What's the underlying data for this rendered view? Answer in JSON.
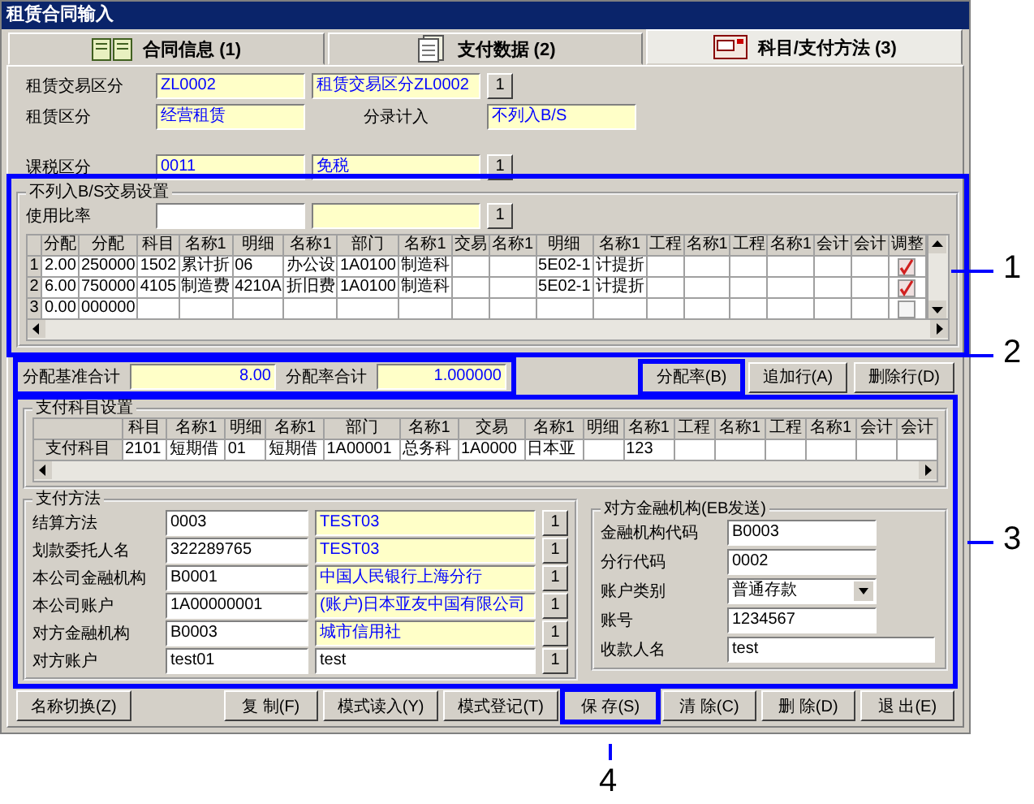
{
  "window": {
    "title": "租赁合同输入"
  },
  "tabs": [
    {
      "label": "合同信息 (1)",
      "selected": false
    },
    {
      "label": "支付数据 (2)",
      "selected": false
    },
    {
      "label": "科目/支付方法 (3)",
      "selected": true
    }
  ],
  "header": [
    {
      "kind": "pair",
      "label": "租赁交易区分",
      "code": "ZL0002",
      "name": "租赁交易区分ZL0002",
      "button": "1"
    },
    {
      "kind": "split",
      "label": "租赁区分",
      "code": "经营租赁",
      "label2": "分录计入",
      "name": "不列入B/S"
    },
    {
      "kind": "pair",
      "label": "课税区分",
      "code": "0011",
      "name": "免税",
      "button": "1"
    }
  ],
  "allocation": {
    "title": "不列入B/S交易设置",
    "callout": "1",
    "rate_label": "使用比率",
    "rate_button": "1",
    "columns": [
      "分配",
      "分配",
      "科目",
      "名称1",
      "明细",
      "名称1",
      "部门",
      "名称1",
      "交易",
      "名称1",
      "明细",
      "名称1",
      "工程",
      "名称1",
      "工程",
      "名称1",
      "会计",
      "会计",
      "调整"
    ],
    "rows": [
      {
        "number": "1",
        "cells": [
          "2.00",
          "250000",
          "1502",
          "累计折",
          "06",
          "办公设",
          "1A0100",
          "制造科",
          "",
          "",
          "5E02-1",
          "计提折",
          "",
          "",
          "",
          "",
          "",
          ""
        ],
        "adjusted": true
      },
      {
        "number": "2",
        "cells": [
          "6.00",
          "750000",
          "4105",
          "制造费",
          "4210A",
          "折旧费",
          "1A0100",
          "制造科",
          "",
          "",
          "5E02-1",
          "计提折",
          "",
          "",
          "",
          "",
          "",
          ""
        ],
        "adjusted": true
      },
      {
        "number": "3",
        "cells": [
          "0.00",
          "000000",
          "",
          "",
          "",
          "",
          "",
          "",
          "",
          "",
          "",
          "",
          "",
          "",
          "",
          "",
          "",
          ""
        ],
        "adjusted": false
      }
    ]
  },
  "totals": {
    "highlighted": true,
    "base_label": "分配基准合计",
    "base_value": "8.00",
    "rate_label": "分配率合计",
    "rate_value": "1.000000"
  },
  "allocation_buttons": [
    {
      "label": "分配率(B)",
      "callout": "2"
    },
    {
      "label": "追加行(A)"
    },
    {
      "label": "删除行(D)"
    }
  ],
  "payment_account": {
    "title": "支付科目设置",
    "callout": "3",
    "columns": [
      "科目",
      "名称1",
      "明细",
      "名称1",
      "部门",
      "名称1",
      "交易",
      "名称1",
      "明细",
      "名称1",
      "工程",
      "名称1",
      "工程",
      "名称1",
      "会计",
      "会计"
    ],
    "row_label": "支付科目",
    "cells": [
      "2101",
      "短期借",
      "01",
      "短期借",
      "1A00001",
      "总务科",
      "1A0000",
      "日本亚",
      "",
      "123",
      "",
      "",
      "",
      "",
      "",
      ""
    ]
  },
  "payment_method": {
    "title": "支付方法",
    "rows": [
      {
        "label": "结算方法",
        "code": "0003",
        "name": "TEST03",
        "readonly": true,
        "button": "1"
      },
      {
        "label": "划款委托人名",
        "code": "322289765",
        "name": "TEST03",
        "readonly": true,
        "button": "1"
      },
      {
        "label": "本公司金融机构",
        "code": "B0001",
        "name": "中国人民银行上海分行",
        "readonly": true,
        "button": "1"
      },
      {
        "label": "本公司账户",
        "code": "1A00000001",
        "name": "(账户)日本亚友中国有限公司",
        "readonly": true,
        "button": "1"
      },
      {
        "label": "对方金融机构",
        "code": "B0003",
        "name": "城市信用社",
        "readonly": true,
        "button": "1"
      },
      {
        "label": "对方账户",
        "code": "test01",
        "name": "test",
        "readonly": false,
        "button": "1"
      }
    ]
  },
  "counterpart_bank": {
    "title": "对方金融机构(EB发送)",
    "fields": [
      {
        "kind": "text",
        "label": "金融机构代码",
        "value": "B0003"
      },
      {
        "kind": "text",
        "label": "分行代码",
        "value": "0002"
      },
      {
        "kind": "select",
        "label": "账户类别",
        "value": "普通存款"
      },
      {
        "kind": "text",
        "label": "账号",
        "value": "1234567"
      },
      {
        "kind": "text",
        "label": "收款人名",
        "value": "test"
      }
    ]
  },
  "footer_buttons": [
    {
      "label": "名称切换(Z)"
    },
    {
      "label": "复 制(F)"
    },
    {
      "label": "模式读入(Y)"
    },
    {
      "label": "模式登记(T)"
    },
    {
      "label": "保 存(S)",
      "callout": "4"
    },
    {
      "label": "清 除(C)"
    },
    {
      "label": "删 除(D)"
    },
    {
      "label": "退 出(E)"
    }
  ]
}
